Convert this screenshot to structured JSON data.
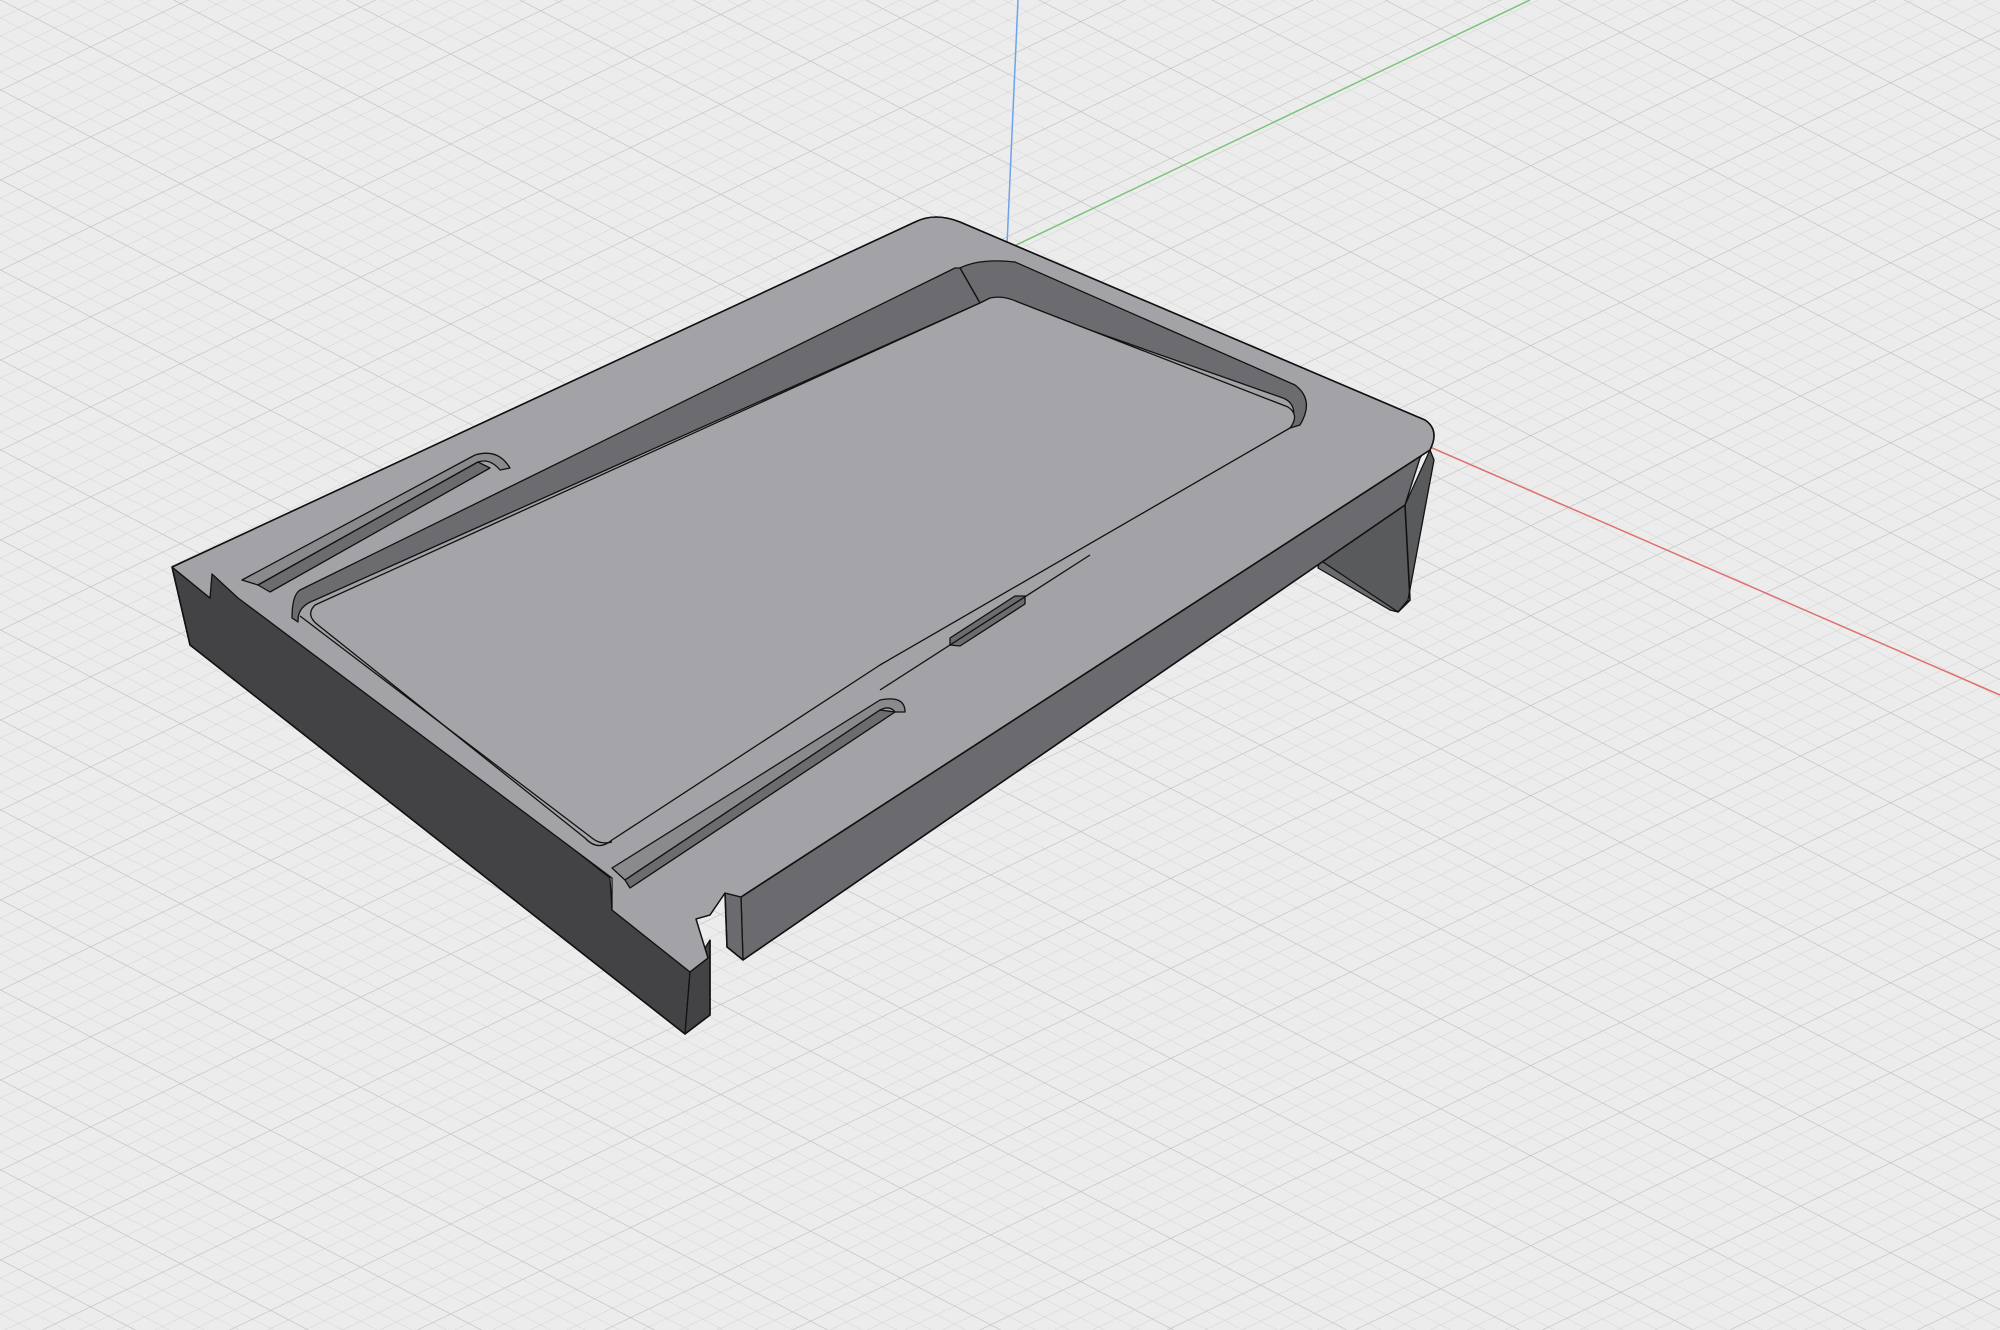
{
  "viewport": {
    "background": "#ececec",
    "grid_minor_color": "#d2d2d2",
    "grid_major_color": "#bdbdbd",
    "axis_colors": {
      "x": "#e07070",
      "y": "#7cc47c",
      "z": "#6ea2ee"
    }
  },
  "model": {
    "kind": "tray-with-pocket",
    "face_colors": {
      "top": "#a3a3a7",
      "pocket_floor": "#a5a5a9",
      "pocket_wall_light": "#8a8a8e",
      "pocket_wall_dark": "#6c6c70",
      "side_left": "#434346",
      "side_front": "#6b6b6f",
      "side_right_inner": "#585a5c",
      "edge": "#111111"
    }
  }
}
